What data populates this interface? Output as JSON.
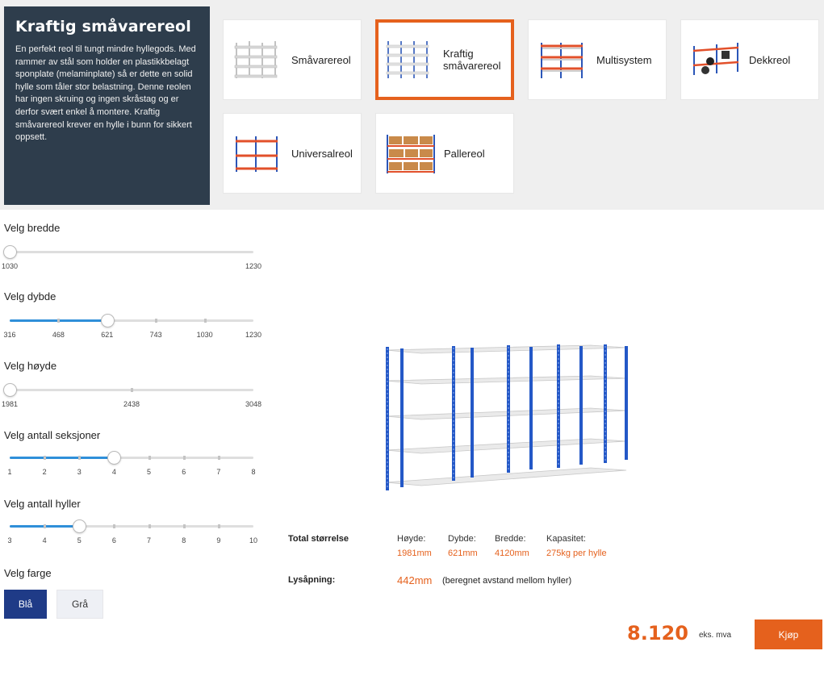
{
  "info": {
    "title": "Kraftig småvarereol",
    "description": "En perfekt reol til tungt mindre hyllegods. Med rammer av stål som holder en plastikkbelagt sponplate (melaminplate) så er dette en solid hylle som tåler stor belastning. Denne reolen har ingen skruing og ingen skråstag og er derfor svært enkel å montere. Kraftig småvarereol krever en hylle i bunn for sikkert oppsett."
  },
  "types": [
    {
      "label": "Småvarereol",
      "icon": "light-shelving-icon",
      "selected": false
    },
    {
      "label": "Kraftig småvarereol",
      "icon": "heavy-shelving-icon",
      "selected": true
    },
    {
      "label": "Multisystem",
      "icon": "multisystem-shelving-icon",
      "selected": false
    },
    {
      "label": "Dekkreol",
      "icon": "tyre-rack-icon",
      "selected": false
    },
    {
      "label": "Universalreol",
      "icon": "universal-shelving-icon",
      "selected": false
    },
    {
      "label": "Pallereol",
      "icon": "pallet-rack-icon",
      "selected": false
    }
  ],
  "controls": {
    "width": {
      "label": "Velg bredde",
      "ticks": [
        "1030",
        "1230"
      ],
      "selected_index": 0
    },
    "depth": {
      "label": "Velg dybde",
      "ticks": [
        "316",
        "468",
        "621",
        "743",
        "1030",
        "1230"
      ],
      "selected_index": 2
    },
    "height": {
      "label": "Velg høyde",
      "ticks": [
        "1981",
        "2438",
        "3048"
      ],
      "selected_index": 0
    },
    "sections": {
      "label": "Velg antall seksjoner",
      "ticks": [
        "1",
        "2",
        "3",
        "4",
        "5",
        "6",
        "7",
        "8"
      ],
      "selected_index": 3
    },
    "shelves": {
      "label": "Velg antall hyller",
      "ticks": [
        "3",
        "4",
        "5",
        "6",
        "7",
        "8",
        "9",
        "10"
      ],
      "selected_index": 2
    },
    "color": {
      "label": "Velg farge",
      "options": [
        "Blå",
        "Grå"
      ],
      "selected": "Blå"
    }
  },
  "colors": {
    "accent": "#e5611d",
    "slider_fill": "#2f8fd9",
    "blue_option": "#1f3b87",
    "panel": "#2e3d4c"
  },
  "summary": {
    "total_label": "Total størrelse",
    "height_label": "Høyde:",
    "height_value": "1981mm",
    "depth_label": "Dybde:",
    "depth_value": "621mm",
    "width_label": "Bredde:",
    "width_value": "4120mm",
    "capacity_label": "Kapasitet:",
    "capacity_value": "275kg per hylle",
    "opening_label": "Lysåpning:",
    "opening_value": "442mm",
    "opening_note": "(beregnet avstand mellom hyller)"
  },
  "price": {
    "amount": "8.120",
    "note": "eks. mva"
  },
  "buy_label": "Kjøp"
}
